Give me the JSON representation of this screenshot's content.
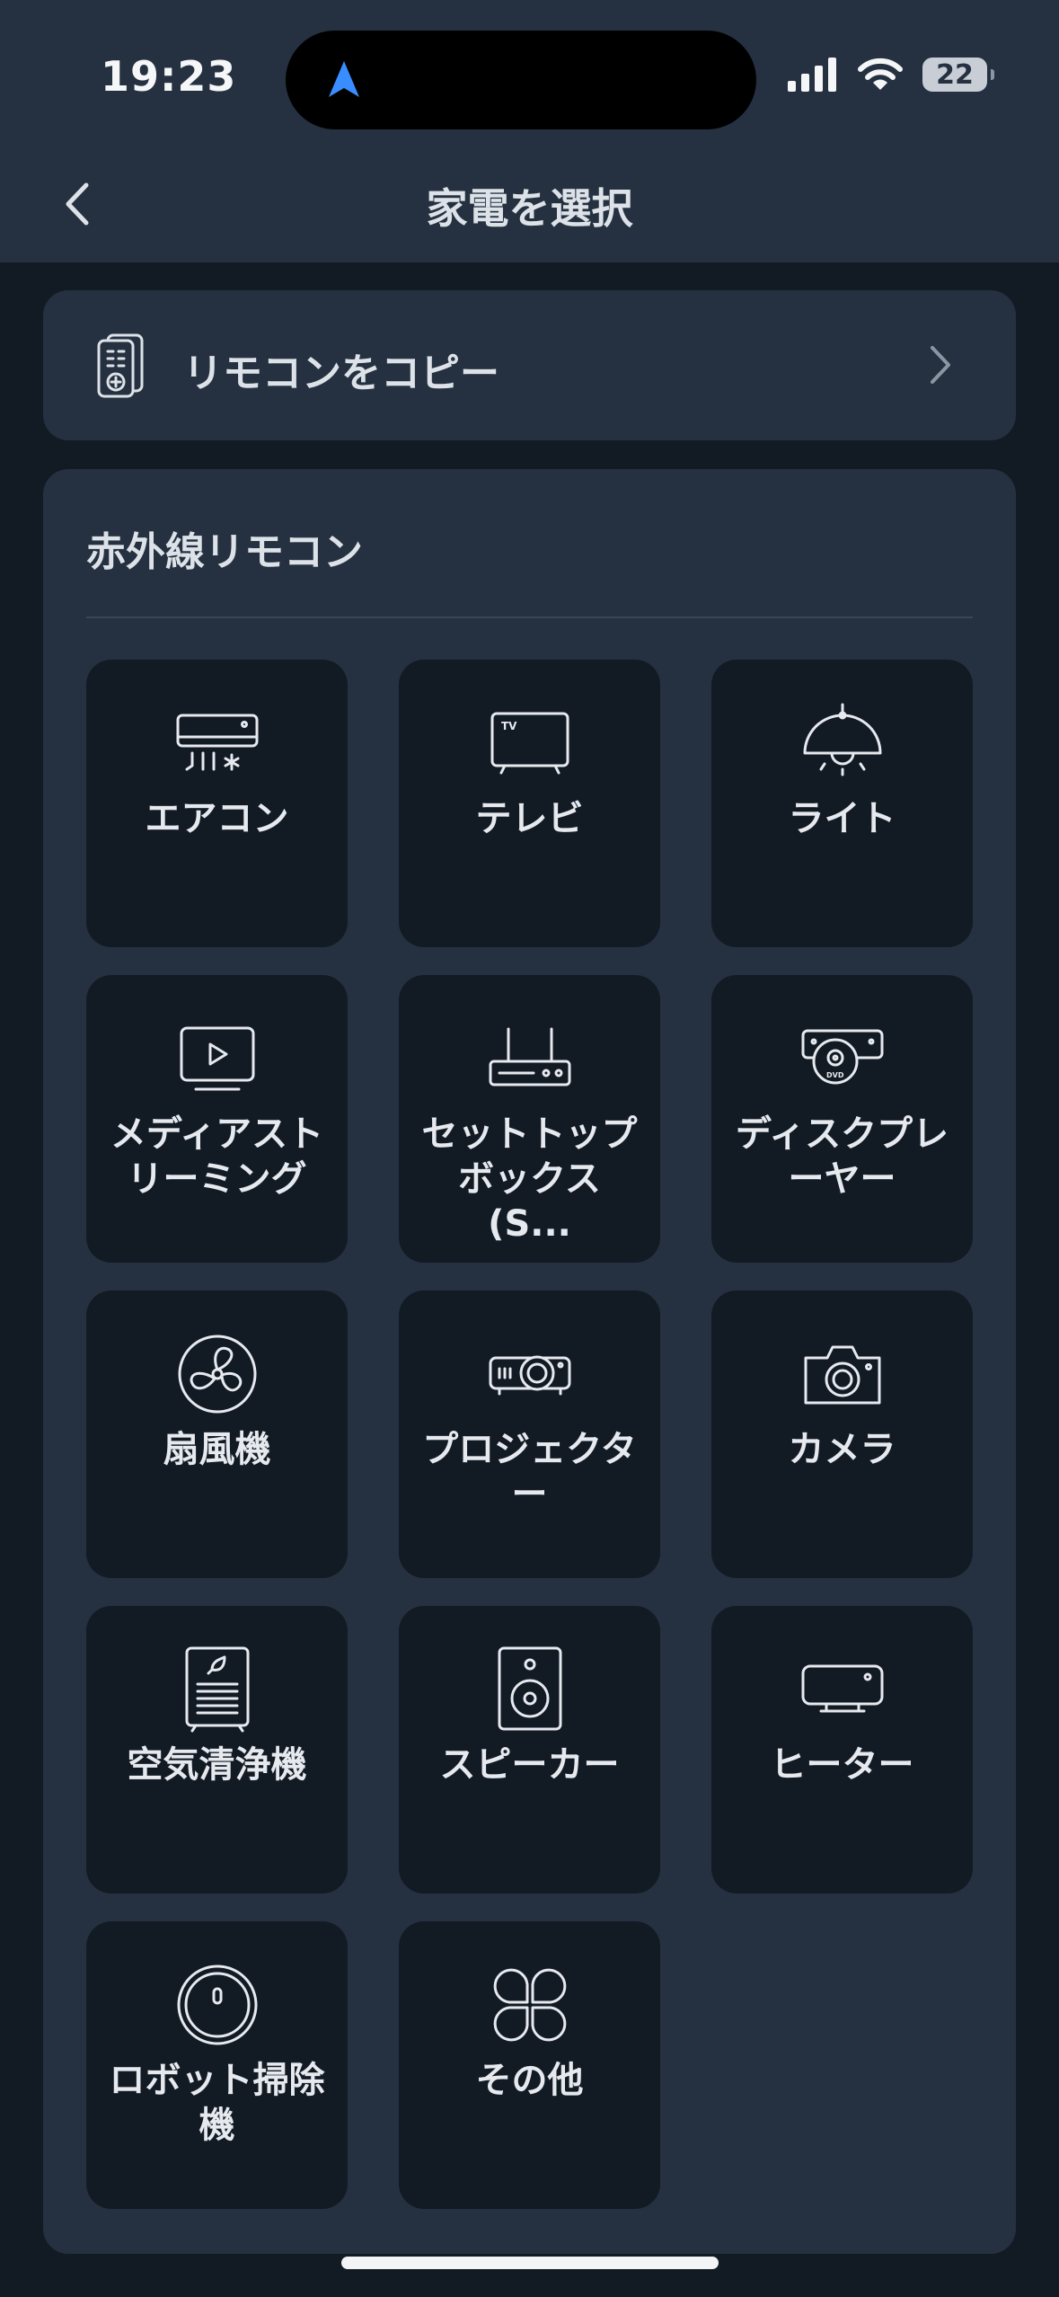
{
  "status_bar": {
    "time": "19:23",
    "battery": "22"
  },
  "nav": {
    "title": "家電を選択"
  },
  "copy_remote": {
    "label": "リモコンをコピー"
  },
  "ir_section": {
    "title": "赤外線リモコン",
    "items": [
      {
        "label": "エアコン",
        "icon": "air-conditioner-icon"
      },
      {
        "label": "テレビ",
        "icon": "tv-icon"
      },
      {
        "label": "ライト",
        "icon": "ceiling-light-icon"
      },
      {
        "label": "メディアストリーミング",
        "icon": "media-streaming-icon"
      },
      {
        "label": "セットトップボックス (S...",
        "icon": "set-top-box-icon"
      },
      {
        "label": "ディスクプレーヤー",
        "icon": "disc-player-icon"
      },
      {
        "label": "扇風機",
        "icon": "fan-icon"
      },
      {
        "label": "プロジェクター",
        "icon": "projector-icon"
      },
      {
        "label": "カメラ",
        "icon": "camera-icon"
      },
      {
        "label": "空気清浄機",
        "icon": "air-purifier-icon"
      },
      {
        "label": "スピーカー",
        "icon": "speaker-icon"
      },
      {
        "label": "ヒーター",
        "icon": "heater-icon"
      },
      {
        "label": "ロボット掃除機",
        "icon": "robot-vacuum-icon"
      },
      {
        "label": "その他",
        "icon": "other-icon"
      }
    ]
  },
  "colors": {
    "background": "#121a24",
    "card": "#253140",
    "accent": "#3a8dff"
  }
}
